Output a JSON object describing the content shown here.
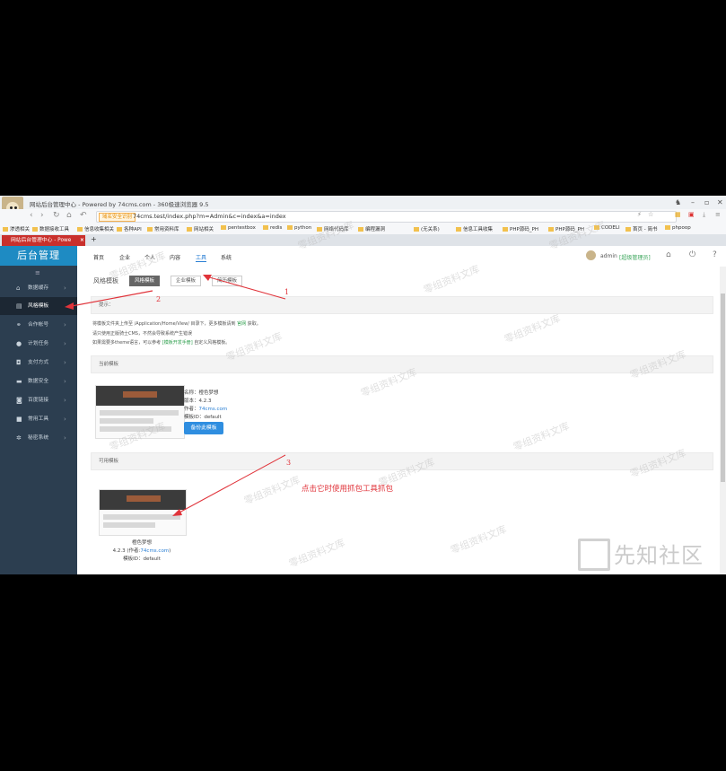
{
  "browser": {
    "window_title": "网站后台管理中心 - Powered by 74cms.com - 360极速浏览器 9.5",
    "url_tag": "域名安全识别",
    "url": "74cms.test/index.php?m=Admin&c=index&a=index",
    "bookmarks": [
      "渗透相关",
      "数据接收工具",
      "信息收集相关",
      "各种API",
      "常用资料库",
      "网站相关",
      "pentestbox",
      "redis",
      "python",
      "网络代码库",
      "编程漏洞",
      "(无关系)",
      "信息工具收集",
      "PHP源码_PH",
      "PHP源码_PH",
      "CODELI",
      "首页 - 简书",
      "phpoop"
    ],
    "tab_title": "网站后台管理中心 - Powe",
    "new_tab": "+"
  },
  "sidebar": {
    "brand": "后台管理",
    "collapse_icon": "≡",
    "items": [
      {
        "label": "数据缓存",
        "icon": "home-icon"
      },
      {
        "label": "风格模板",
        "icon": "template-icon",
        "active": true
      },
      {
        "label": "合作帐号",
        "icon": "share-icon"
      },
      {
        "label": "计划任务",
        "icon": "clock-icon"
      },
      {
        "label": "支付方式",
        "icon": "wallet-icon"
      },
      {
        "label": "数据安全",
        "icon": "database-icon"
      },
      {
        "label": "百度链接",
        "icon": "link-icon"
      },
      {
        "label": "常用工具",
        "icon": "tool-icon"
      },
      {
        "label": "秘密系统",
        "icon": "gear-icon"
      }
    ]
  },
  "topnav": {
    "items": [
      "首页",
      "企业",
      "个人",
      "内容",
      "工具",
      "系统"
    ],
    "active": "工具",
    "user": "admin",
    "role": "[超级管理员]"
  },
  "page": {
    "title": "风格模板",
    "tabs": [
      "风格模板",
      "企业模板",
      "简历模板"
    ],
    "tip_header": "提示：",
    "tips": [
      "将模板文件夹上传至 /Application/Home/View/ 目录下，更多模板请到",
      "官网",
      "获取。",
      "请只使用正版骑士CMS，不然会导致系统产生错误",
      "如果需要多theme语言，可以参考",
      "[模板开发手册]",
      "自定义风格模板。"
    ],
    "current_header": "当前模板",
    "current": {
      "name_label": "名称：",
      "name": "橙色梦想",
      "version_label": "版本：",
      "version": "4.2.3",
      "author_label": "作者：",
      "author": "74cms.com",
      "id_label": "模板ID：",
      "id": "default",
      "backup_button": "备份此模板"
    },
    "available_header": "可用模板",
    "available": {
      "name": "橙色梦想",
      "line2_prefix": "4.2.3 (作者:",
      "author": "74cms.com",
      "line2_suffix": ")",
      "id_line": "模板ID：default"
    }
  },
  "annotations": {
    "note": "点击它时使用抓包工具抓包",
    "marker_1": "1",
    "marker_2": "2",
    "marker_3": "3"
  },
  "watermarks": {
    "text": "零组资料文库",
    "site": "先知社区"
  },
  "colors": {
    "brand_blue": "#1e8bc3",
    "sidebar_bg": "#2c3e50",
    "annotation_red": "#e0333a",
    "tab_red": "#c9302c"
  }
}
